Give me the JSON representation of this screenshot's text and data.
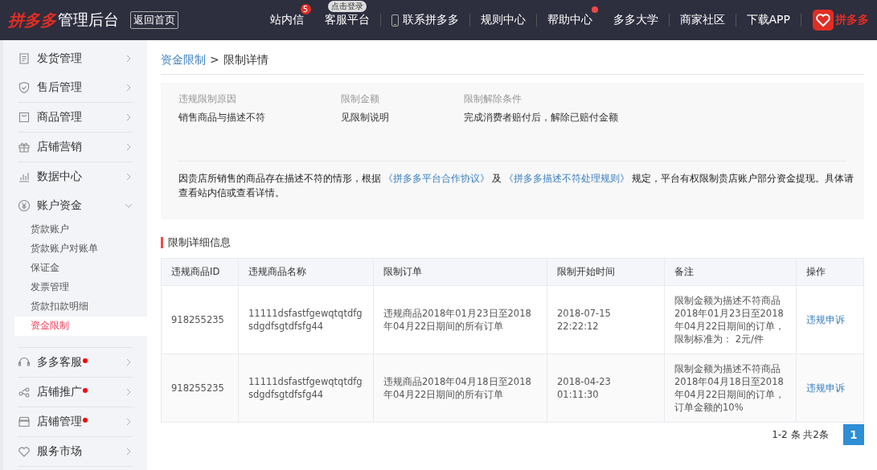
{
  "header": {
    "logo_brand": "拼多多",
    "logo_suffix": "管理后台",
    "home_button": "返回首页",
    "nav": [
      {
        "label": "站内信",
        "badge": "5",
        "dot": false,
        "phone": false
      },
      {
        "label": "客服平台",
        "dot": false,
        "tooltip": "点击登录",
        "phone": false
      },
      {
        "label": "联系拼多多",
        "dot": false,
        "phone": true
      },
      {
        "label": "规则中心",
        "dot": false,
        "phone": false
      },
      {
        "label": "帮助中心",
        "dot": true,
        "phone": false
      },
      {
        "label": "多多大学",
        "dot": false,
        "phone": false
      },
      {
        "label": "商家社区",
        "dot": false,
        "phone": false
      },
      {
        "label": "下载APP",
        "dot": false,
        "phone": false
      }
    ],
    "right_logo": "拼多多"
  },
  "sidebar": {
    "items": [
      {
        "label": "发货管理",
        "dot": false,
        "expanded": false
      },
      {
        "label": "售后管理",
        "dot": false,
        "expanded": false
      },
      {
        "label": "商品管理",
        "dot": false,
        "expanded": false
      },
      {
        "label": "店铺营销",
        "dot": false,
        "expanded": false
      },
      {
        "label": "数据中心",
        "dot": false,
        "expanded": false
      },
      {
        "label": "账户资金",
        "dot": false,
        "expanded": true,
        "children": [
          {
            "label": "货款账户",
            "selected": false
          },
          {
            "label": "货款账户对账单",
            "selected": false
          },
          {
            "label": "保证金",
            "selected": false
          },
          {
            "label": "发票管理",
            "selected": false
          },
          {
            "label": "货款扣款明细",
            "selected": false
          },
          {
            "label": "资金限制",
            "selected": true
          }
        ]
      },
      {
        "label": "多多客服",
        "dot": true,
        "expanded": false
      },
      {
        "label": "店铺推广",
        "dot": true,
        "expanded": false
      },
      {
        "label": "店铺管理",
        "dot": true,
        "expanded": false
      },
      {
        "label": "服务市场",
        "dot": false,
        "expanded": false
      }
    ]
  },
  "breadcrumb": [
    {
      "label": "资金限制"
    },
    {
      "label": "限制详情"
    }
  ],
  "breadcrumb_separator": ">",
  "summary": {
    "fields": [
      {
        "label": "违规限制原因",
        "value": "销售商品与描述不符"
      },
      {
        "label": "限制金额",
        "value": "见限制说明"
      },
      {
        "label": "限制解除条件",
        "value": "完成消费者赔付后，解除已赔付金额"
      }
    ],
    "notice": [
      {
        "text": "因贵店所销售的商品存在描述不符的情形，根据",
        "link": false
      },
      {
        "text": "《拼多多平台合作协议》",
        "link": true
      },
      {
        "text": "及",
        "link": false
      },
      {
        "text": "《拼多多描述不符处理规则》",
        "link": true
      },
      {
        "text": "规定，平台有权限制贵店账户部分资金提现。具体请查看站内信或查看详情。",
        "link": false
      }
    ]
  },
  "section_title": "限制详细信息",
  "table": {
    "columns": [
      "违规商品ID",
      "违规商品名称",
      "限制订单",
      "限制开始时间",
      "备注",
      "操作"
    ],
    "rows": [
      {
        "id": "918255235",
        "name": "11111dsfastfgewqtqtdfgsdgdfsgtdfsfg44",
        "order": "违规商品2018年01月23日至2018年04月22日期间的所有订单",
        "start": "2018-07-15 22:22:12",
        "note": "限制金额为描述不符商品2018年01月23日至2018年04月22日期间的订单，限制标准为： 2元/件",
        "action": "违规申诉"
      },
      {
        "id": "918255235",
        "name": "11111dsfastfgewqtqtdfgsdgdfsgtdfsfg44",
        "order": "违规商品2018年04月18日至2018年04月22日期间的所有订单",
        "start": "2018-04-23 01:11:30",
        "note": "限制金额为描述不符商品2018年04月18日至2018年04月22日期间的订单，订单金额的10%",
        "action": "违规申诉"
      }
    ]
  },
  "pagination": {
    "summary": "1-2 条 共2条",
    "pages": [
      {
        "label": "1",
        "selected": true
      }
    ]
  }
}
